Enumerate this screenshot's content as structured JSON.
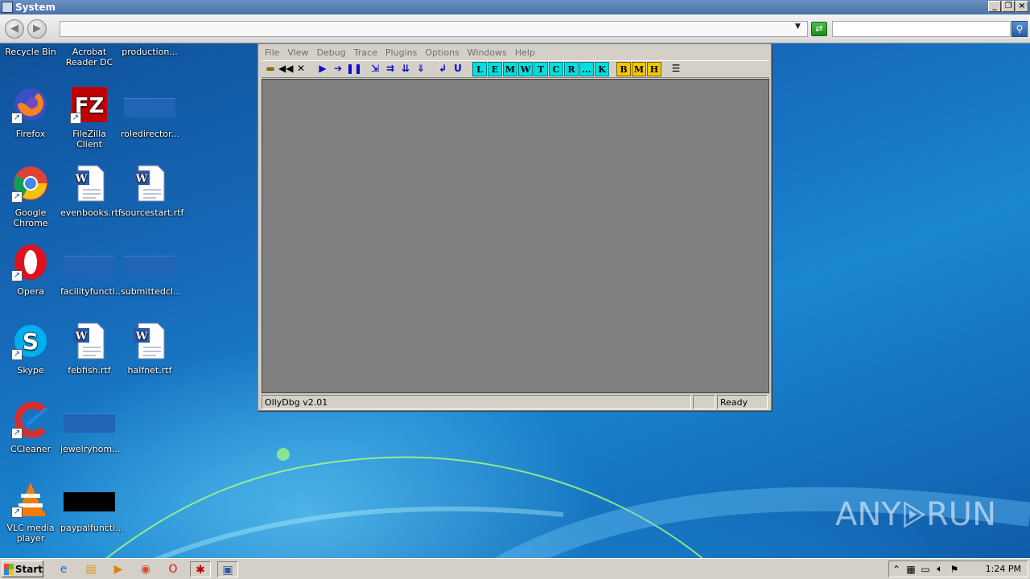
{
  "window": {
    "title": "System"
  },
  "explorer": {
    "address": "",
    "search_placeholder": ""
  },
  "desktop_icons": [
    {
      "label": "Recycle Bin",
      "icon": "recycle-bin-icon"
    },
    {
      "label": "Acrobat Reader DC",
      "icon": "acrobat-icon"
    },
    {
      "label": "production...",
      "icon": "blank-file-icon"
    },
    {
      "label": "Firefox",
      "icon": "firefox-icon"
    },
    {
      "label": "FileZilla Client",
      "icon": "filezilla-icon"
    },
    {
      "label": "roledirector...",
      "icon": "blank-file-icon"
    },
    {
      "label": "Google Chrome",
      "icon": "chrome-icon"
    },
    {
      "label": "evenbooks.rtf",
      "icon": "word-doc-icon"
    },
    {
      "label": "sourcestart.rtf",
      "icon": "word-doc-icon"
    },
    {
      "label": "Opera",
      "icon": "opera-icon"
    },
    {
      "label": "facilityfuncti...",
      "icon": "blank-file-icon"
    },
    {
      "label": "submittedcl...",
      "icon": "blank-file-icon"
    },
    {
      "label": "Skype",
      "icon": "skype-icon"
    },
    {
      "label": "febfish.rtf",
      "icon": "word-doc-icon"
    },
    {
      "label": "halfnet.rtf",
      "icon": "word-doc-icon"
    },
    {
      "label": "CCleaner",
      "icon": "ccleaner-icon"
    },
    {
      "label": "jewelryhom...",
      "icon": "blank-file-icon"
    },
    {
      "label": "VLC media player",
      "icon": "vlc-icon"
    },
    {
      "label": "paypalfuncti...",
      "icon": "black-file-icon"
    }
  ],
  "ollydbg": {
    "menu": [
      "File",
      "View",
      "Debug",
      "Trace",
      "Plugins",
      "Options",
      "Windows",
      "Help"
    ],
    "toolbar_letters_cyan": [
      "L",
      "E",
      "M",
      "W",
      "T",
      "C",
      "R",
      "...",
      "K"
    ],
    "toolbar_letters_yellow": [
      "B",
      "M",
      "H"
    ],
    "status_left": "OllyDbg v2.01",
    "status_middle": "",
    "status_right": "Ready"
  },
  "watermark": {
    "text_left": "ANY",
    "text_right": "RUN"
  },
  "taskbar": {
    "start_label": "Start",
    "clock": "1:24 PM"
  },
  "colors": {
    "olly_client": "#808080",
    "toolbar_cyan": "#00e0e0",
    "toolbar_yellow": "#f0c800"
  }
}
